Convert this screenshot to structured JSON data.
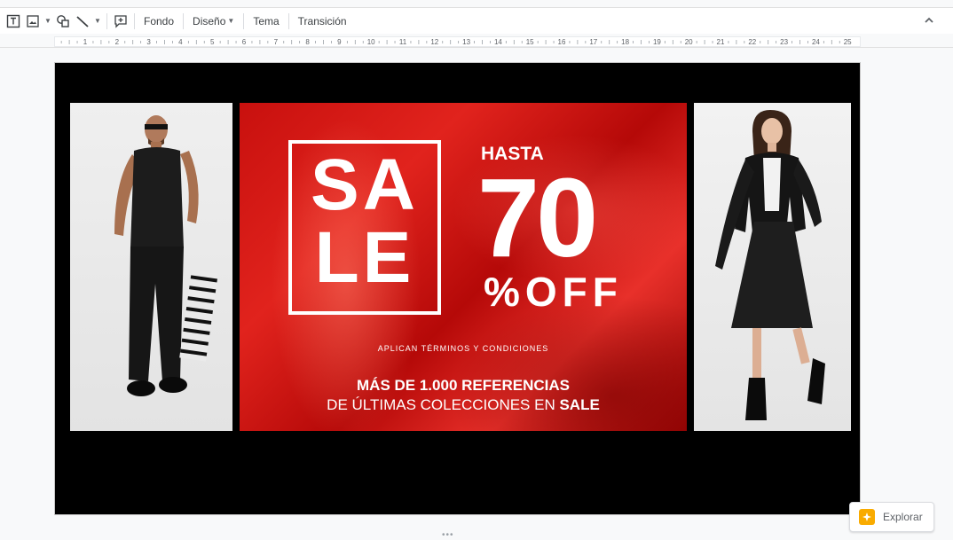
{
  "toolbar": {
    "icons": [
      "textbox-icon",
      "image-icon",
      "shape-icon",
      "line-icon",
      "comment-icon"
    ],
    "background_label": "Fondo",
    "layout_label": "Diseño",
    "theme_label": "Tema",
    "transition_label": "Transición"
  },
  "ruler": {
    "numbers": [
      "1",
      "2",
      "3",
      "4",
      "5",
      "6",
      "7",
      "8",
      "9",
      "10",
      "11",
      "12",
      "13",
      "14",
      "15",
      "16",
      "17",
      "18",
      "19",
      "20",
      "21",
      "22",
      "23",
      "24",
      "25"
    ]
  },
  "slide": {
    "banner": {
      "sale_line1": "SA",
      "sale_line2": "LE",
      "hasta": "HASTA",
      "percent": "70",
      "off": "%OFF",
      "terms": "APLICAN TÉRMINOS Y CONDICIONES",
      "line1": "MÁS DE 1.000 REFERENCIAS",
      "line2_prefix": "DE ÚLTIMAS COLECCIONES EN ",
      "line2_bold": "SALE"
    }
  },
  "explore": {
    "label": "Explorar"
  },
  "colors": {
    "banner_red": "#d3140f",
    "explore_accent": "#f9ab00"
  }
}
